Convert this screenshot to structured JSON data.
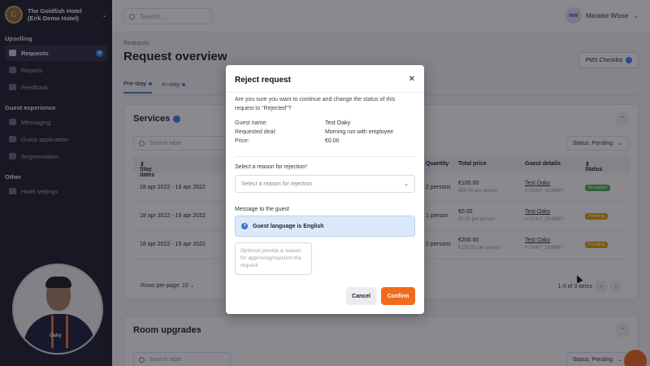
{
  "sidebar": {
    "hotel_name": "The Goldfish Hotel (Erik Demo Hotel)",
    "sections": [
      {
        "title": "Upselling",
        "items": [
          {
            "label": "Requests",
            "active": true,
            "badge": true
          },
          {
            "label": "Reports"
          },
          {
            "label": "Feedback"
          }
        ]
      },
      {
        "title": "Guest experience",
        "items": [
          {
            "label": "Messaging"
          },
          {
            "label": "Guest application"
          },
          {
            "label": "Segmentation"
          }
        ]
      },
      {
        "title": "Other",
        "items": [
          {
            "label": "Hotel settings"
          }
        ]
      }
    ]
  },
  "topbar": {
    "search_placeholder": "Search...",
    "user_initials": "MW",
    "user_name": "Marieke Wisse"
  },
  "main": {
    "breadcrumb": "Requests",
    "title": "Request overview",
    "pms_button": "PMS Checklist",
    "tabs": [
      "Pre-stay",
      "In-stay"
    ]
  },
  "services": {
    "title": "Services",
    "search_placeholder": "Search table",
    "status_filter": "Status: Pending",
    "columns": [
      "Stay dates",
      "Quantity",
      "Total price",
      "Guest details",
      "Status"
    ],
    "rows": [
      {
        "dates": "18 apr 2022 - 19 apr 2022",
        "qty": "2 persons",
        "price": "€100.00",
        "price_sub": "€50.00 per person",
        "guest": "Test Oaky",
        "guest_sub": "# OAKY_DUMMY",
        "status": "Accepted",
        "status_color": "#4caf50"
      },
      {
        "dates": "18 apr 2022 - 19 apr 2022",
        "qty": "1 person",
        "price": "€0.00",
        "price_sub": "€0.00 per person",
        "guest": "Test Oaky",
        "guest_sub": "# OAKY_DUMMY",
        "status": "Pending",
        "status_color": "#e0a000"
      },
      {
        "dates": "18 apr 2022 - 19 apr 2022",
        "qty": "2 persons",
        "price": "€200.00",
        "price_sub": "€120.00 per person",
        "guest": "Test Oaky",
        "guest_sub": "# OAKY_DUMMY",
        "status": "Pending",
        "status_color": "#e0a000"
      }
    ],
    "rows_per_page_label": "Rows per page:",
    "rows_per_page_value": "10",
    "pagination": "1-3 of 3 items"
  },
  "room_upgrades": {
    "title": "Room upgrades",
    "search_placeholder": "Search table",
    "status_filter": "Status: Pending"
  },
  "modal": {
    "title": "Reject request",
    "question": "Are you sure you want to continue and change the status of this request to \"Rejected\"?",
    "guest_name_label": "Guest name:",
    "guest_name": "Test Oaky",
    "deal_label": "Requested deal:",
    "deal": "Morning run with employee",
    "price_label": "Price:",
    "price": "€0.00",
    "reason_label": "Select a reason for rejection",
    "reason_placeholder": "Select a reason for rejection",
    "message_label": "Message to the guest",
    "language_notice": "Guest language is English",
    "message_placeholder": "Optional provide a reason for approving/rejection the request",
    "cancel": "Cancel",
    "confirm": "Confirm"
  },
  "colors": {
    "accent": "#f26b1d",
    "sidebar_bg": "#1c1a2b",
    "info_bg": "#dbe9fb"
  }
}
